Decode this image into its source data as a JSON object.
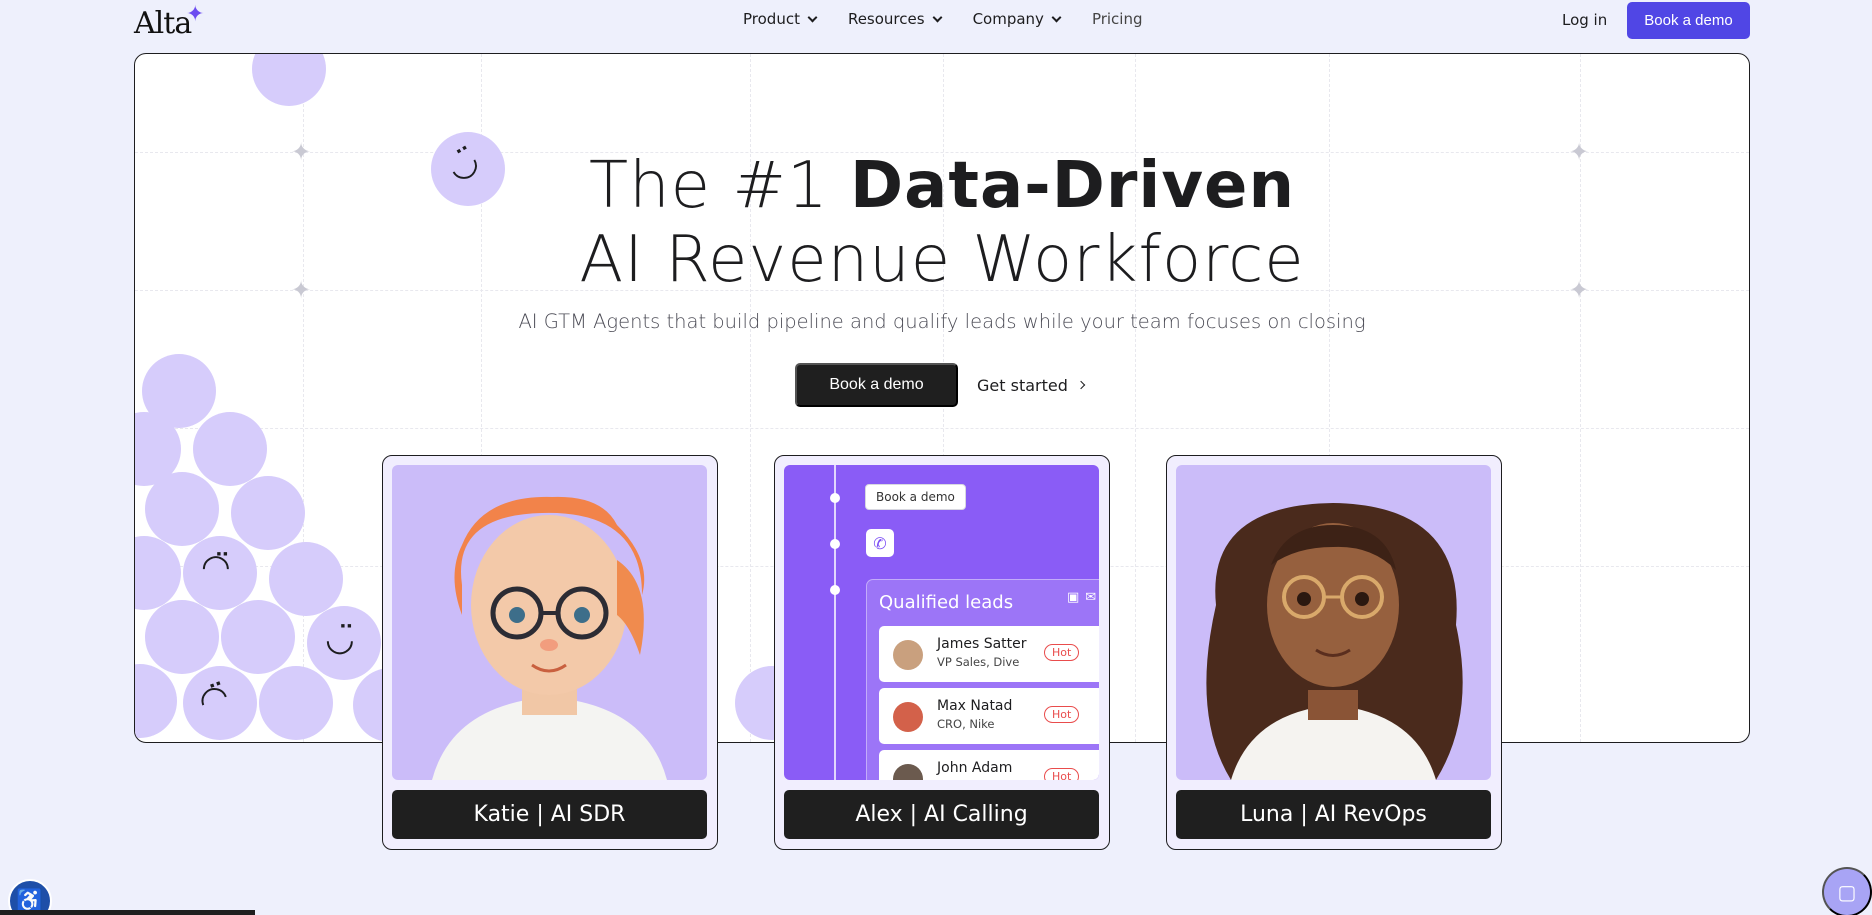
{
  "nav": {
    "logo": "Alta",
    "links": [
      {
        "label": "Product",
        "dropdown": true
      },
      {
        "label": "Resources",
        "dropdown": true
      },
      {
        "label": "Company",
        "dropdown": true
      },
      {
        "label": "Pricing",
        "dropdown": false
      }
    ],
    "login": "Log in",
    "cta": "Book a demo"
  },
  "hero": {
    "headline_light_1": "The #1 ",
    "headline_bold": "Data-Driven",
    "headline_line_2": "AI Revenue Workforce",
    "subheadline": "AI GTM Agents that build pipeline and qualify leads while your team focuses on closing",
    "primary_cta": "Book a demo",
    "secondary_cta": "Get started"
  },
  "agents": [
    {
      "label": "Katie | AI SDR"
    },
    {
      "label": "Alex | AI Calling"
    },
    {
      "label": "Luna | AI RevOps"
    }
  ],
  "alex_mock": {
    "button": "Book a demo",
    "panel_title": "Qualified leads",
    "leads": [
      {
        "name": "James Satter",
        "role": "VP Sales, Dive",
        "tag": "Hot"
      },
      {
        "name": "Max Natad",
        "role": "CRO, Nike",
        "tag": "Hot"
      },
      {
        "name": "John Adam",
        "role": "",
        "tag": "Hot"
      }
    ]
  },
  "colors": {
    "accent": "#5046e5",
    "bubble": "#d6ccfb",
    "card_purple": "#cbbcf9",
    "alex_purple": "#8a5cf6",
    "page_bg": "#eef0fc"
  },
  "icons": {
    "logo_star": "sparkle-icon",
    "phone": "phone-icon",
    "linkedin": "linkedin-icon",
    "mail": "mail-icon",
    "accessibility": "accessibility-icon",
    "chat": "chat-icon"
  }
}
